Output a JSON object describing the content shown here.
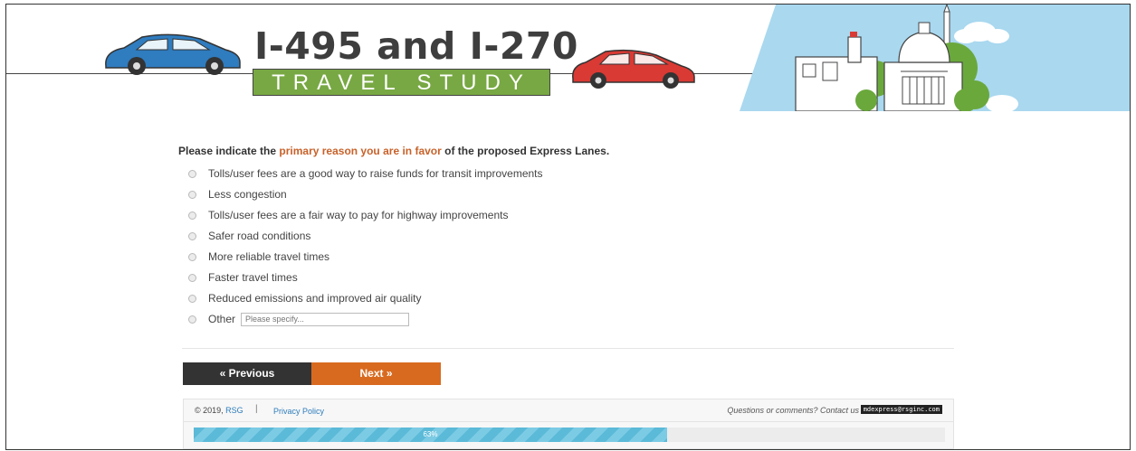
{
  "header": {
    "title_line1": "I-495 and I-270",
    "title_line2": "TRAVEL STUDY"
  },
  "question": {
    "prefix": "Please indicate the ",
    "highlight": "primary reason you are in favor",
    "suffix": " of the proposed Express Lanes."
  },
  "options": [
    {
      "label": "Tolls/user fees are a good way to raise funds for transit improvements"
    },
    {
      "label": "Less congestion"
    },
    {
      "label": "Tolls/user fees are a fair way to pay for highway improvements"
    },
    {
      "label": "Safer road conditions"
    },
    {
      "label": "More reliable travel times"
    },
    {
      "label": "Faster travel times"
    },
    {
      "label": "Reduced emissions and improved air quality"
    },
    {
      "label": "Other"
    }
  ],
  "other_input": {
    "placeholder": "Please specify..."
  },
  "nav": {
    "previous_label": "« Previous",
    "next_label": "Next »"
  },
  "footer": {
    "copyright": "© 2019,",
    "company_link": "RSG",
    "separator": "|",
    "privacy_link": "Privacy Policy",
    "contact_text": "Questions or comments? Contact us at",
    "email": "mdexpress@rsginc.com"
  },
  "progress": {
    "value": 0.63,
    "label": "63%"
  },
  "colors": {
    "accent_orange": "#d86a1f",
    "question_highlight": "#c8622a",
    "title_green": "#78a843",
    "car_blue": "#2f7cbf",
    "car_red": "#d93a34",
    "sky_blue": "#a9d8ef",
    "progress_blue": "#5bbad8"
  },
  "icons": {
    "blue_car": "blue-car-illustration",
    "red_car": "red-car-illustration",
    "skyline": "washington-skyline-illustration"
  }
}
